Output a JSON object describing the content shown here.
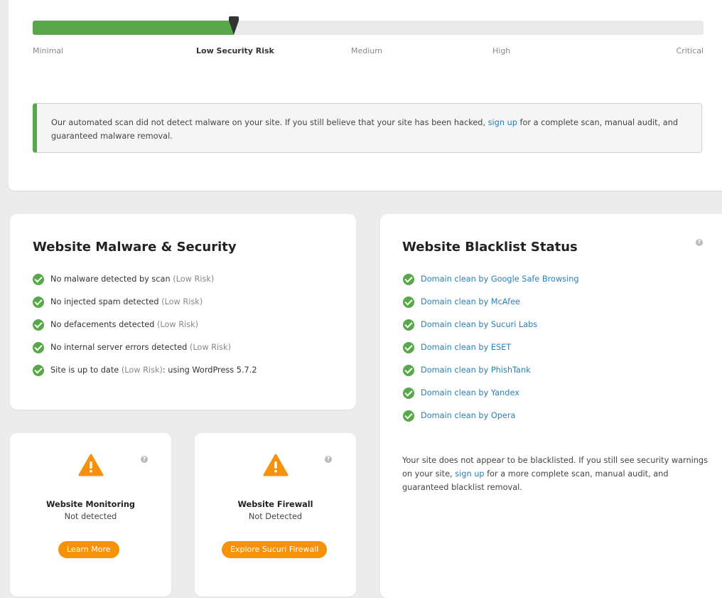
{
  "risk_meter": {
    "levels": [
      "Minimal",
      "Low Security Risk",
      "Medium",
      "High",
      "Critical"
    ],
    "current_level": "Low Security Risk",
    "fill_fraction": 0.3,
    "fill_color": "#58a849"
  },
  "notice": {
    "text_before": "Our automated scan did not detect malware on your site. If you still believe that your site has been hacked, ",
    "link": "sign up",
    "text_after": " for a complete scan, manual audit, and guaranteed malware removal."
  },
  "malware_card": {
    "title": "Website Malware & Security",
    "items": [
      {
        "text": "No malware detected by scan",
        "risk": "(Low Risk)",
        "extra": ""
      },
      {
        "text": "No injected spam detected",
        "risk": "(Low Risk)",
        "extra": ""
      },
      {
        "text": "No defacements detected",
        "risk": "(Low Risk)",
        "extra": ""
      },
      {
        "text": "No internal server errors detected",
        "risk": "(Low Risk)",
        "extra": ""
      },
      {
        "text": "Site is up to date",
        "risk": "(Low Risk)",
        "extra": ": using WordPress 5.7.2"
      }
    ]
  },
  "blacklist_card": {
    "title": "Website Blacklist Status",
    "help_icon": "question-circle-icon",
    "items": [
      "Domain clean by Google Safe Browsing",
      "Domain clean by McAfee",
      "Domain clean by Sucuri Labs",
      "Domain clean by ESET",
      "Domain clean by PhishTank",
      "Domain clean by Yandex",
      "Domain clean by Opera"
    ],
    "note_before": "Your site does not appear to be blacklisted. If you still see security warnings on your site, ",
    "note_link": "sign up",
    "note_after": " for a more complete scan, manual audit, and guaranteed blacklist removal."
  },
  "monitoring_card": {
    "title": "Website Monitoring",
    "status": "Not detected",
    "button": "Learn More",
    "icon": "warning-icon"
  },
  "firewall_card": {
    "title": "Website Firewall",
    "status": "Not Detected",
    "button": "Explore Sucuri Firewall",
    "icon": "warning-icon"
  },
  "colors": {
    "accent_green": "#58a849",
    "warning_orange": "#f5920a",
    "link_blue": "#2b7fb5"
  }
}
